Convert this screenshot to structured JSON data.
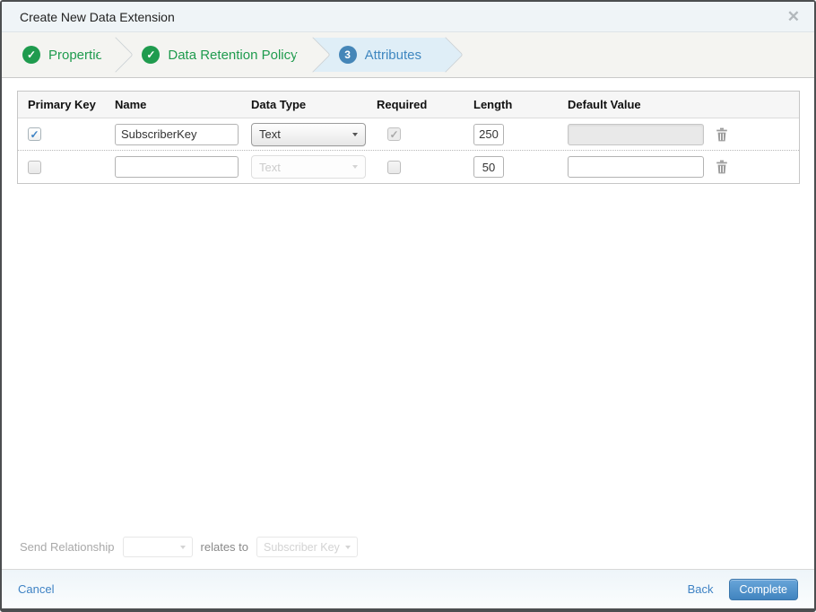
{
  "modal": {
    "title": "Create New Data Extension",
    "close_glyph": "✕"
  },
  "wizard": {
    "steps": [
      {
        "label": "Properties",
        "status": "complete"
      },
      {
        "label": "Data Retention Policy",
        "status": "complete"
      },
      {
        "label": "Attributes",
        "status": "current",
        "number": "3"
      }
    ]
  },
  "attributes_table": {
    "headers": [
      "Primary Key",
      "Name",
      "Data Type",
      "Required",
      "Length",
      "Default Value"
    ],
    "rows": [
      {
        "primary_key": true,
        "name": "SubscriberKey",
        "data_type": "Text",
        "data_type_enabled": true,
        "required": true,
        "required_enabled": false,
        "length": "250",
        "default_value": "",
        "default_value_enabled": false
      },
      {
        "primary_key": false,
        "name": "",
        "data_type": "Text",
        "data_type_enabled": false,
        "required": false,
        "required_enabled": true,
        "length": "50",
        "default_value": "",
        "default_value_enabled": true
      }
    ]
  },
  "send_relationship": {
    "label": "Send Relationship",
    "source_value": "",
    "relates_label": "relates to",
    "target_value": "Subscriber Key"
  },
  "footer": {
    "cancel_label": "Cancel",
    "back_label": "Back",
    "complete_label": "Complete"
  },
  "colors": {
    "step_complete_green": "#1f9b4e",
    "step_current_blue": "#4586b8",
    "active_step_bg": "#dfeef7",
    "link_blue": "#3e82c4",
    "complete_button_blue": "#4184bf",
    "checkbox_check_blue": "#3d82c4"
  }
}
